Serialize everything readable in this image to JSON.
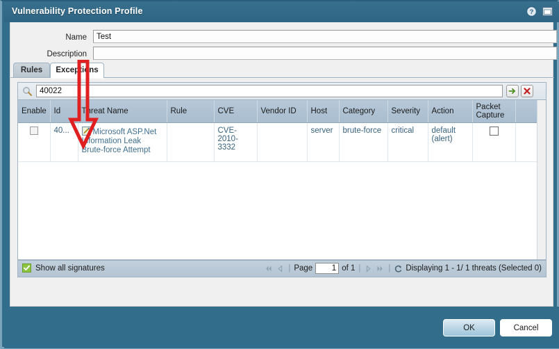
{
  "window": {
    "title": "Vulnerability Protection Profile",
    "help_icon": "help-circle-icon",
    "maximize_icon": "window-maximize-icon"
  },
  "form": {
    "name_label": "Name",
    "name_value": "Test",
    "name_placeholder": "",
    "description_label": "Description",
    "description_value": "",
    "description_placeholder": ""
  },
  "tabs": [
    {
      "label": "Rules",
      "active": false
    },
    {
      "label": "Exceptions",
      "active": true
    }
  ],
  "search": {
    "value": "40022",
    "placeholder": "",
    "icon": "search-icon",
    "go_icon": "arrow-right-icon",
    "clear_icon": "close-x-icon"
  },
  "table": {
    "columns": [
      "Enable",
      "Id",
      "Threat Name",
      "Rule",
      "CVE",
      "Vendor ID",
      "Host",
      "Category",
      "Severity",
      "Action",
      "Packet Capture",
      ""
    ],
    "rows": [
      {
        "enable": "",
        "id": "40...",
        "threat_name": "Microsoft ASP.Net Information Leak Brute-force Attempt",
        "threat_icon": "edit-pencil-icon",
        "rule": "",
        "cve": "CVE-2010-3332",
        "vendor_id": "",
        "host": "server",
        "category": "brute-force",
        "severity": "critical",
        "action": "default (alert)",
        "packet_capture": "",
        "trailing": ""
      }
    ]
  },
  "status": {
    "show_all_label": "Show all signatures",
    "show_all_checked": true,
    "first_icon": "page-first-icon",
    "prev_icon": "page-prev-icon",
    "page_label": "Page",
    "page_value": "1",
    "of_label": "of 1",
    "next_icon": "page-next-icon",
    "last_icon": "page-last-icon",
    "refresh_icon": "refresh-icon",
    "display_text": "Displaying 1 - 1/ 1 threats (Selected 0)"
  },
  "footer": {
    "ok_label": "OK",
    "cancel_label": "Cancel"
  },
  "annotation": {
    "arrow": "red-down-arrow-annotation"
  },
  "colors": {
    "window_chrome": "#336d8c",
    "title_bar": "#2f6584",
    "header_row": "#a8bdcf",
    "link_text": "#36617e",
    "accent_green": "#8cc63f",
    "annotation_red": "#e02020"
  }
}
